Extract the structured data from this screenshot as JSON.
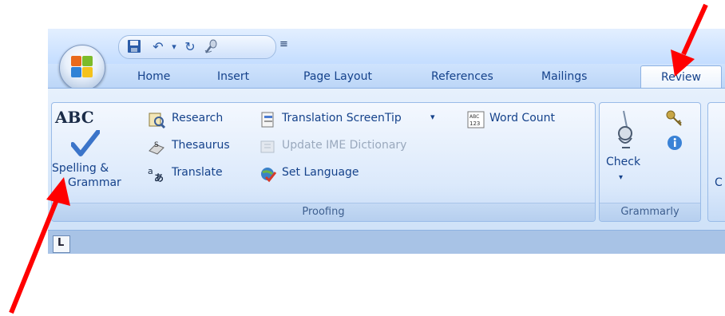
{
  "quick_access": {
    "customize_glyph": "≡"
  },
  "tabs": [
    "Home",
    "Insert",
    "Page Layout",
    "References",
    "Mailings",
    "Review"
  ],
  "proofing": {
    "spelling_icon_text": "ABC",
    "spelling_line1": "Spelling &",
    "spelling_line2": "Grammar",
    "research": "Research",
    "thesaurus": "Thesaurus",
    "translate": "Translate",
    "translation_screentip": "Translation ScreenTip",
    "update_ime": "Update IME Dictionary",
    "set_language": "Set Language",
    "word_count": "Word Count",
    "group_label": "Proofing"
  },
  "grammarly": {
    "check": "Check",
    "group_label": "Grammarly"
  },
  "next_group_partial": "C",
  "annotation_color": "#ff0000"
}
